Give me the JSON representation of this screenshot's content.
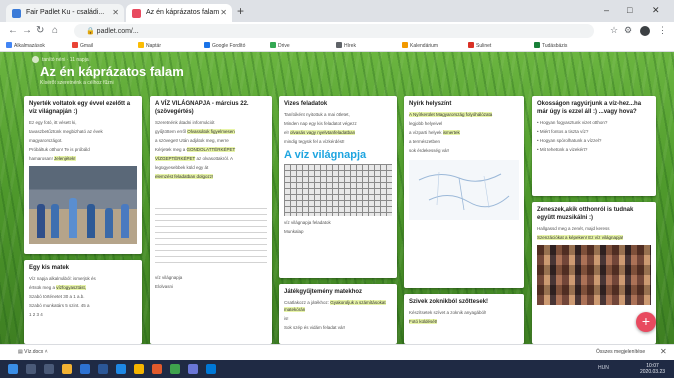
{
  "browser": {
    "tabs": [
      {
        "label": "Fair Padlet Ku - családi..."
      },
      {
        "label": "Az én káprázatos falam"
      }
    ],
    "new_tab": "+",
    "url": "padlet.com/...",
    "window_controls": {
      "minimize": "–",
      "maximize": "□",
      "close": "✕"
    }
  },
  "bookmarks": [
    {
      "label": "Alkalmazások",
      "color": "#4285f4"
    },
    {
      "label": "Gmail",
      "color": "#e94335"
    },
    {
      "label": "Naptár",
      "color": "#fbbc04"
    },
    {
      "label": "Google Fordító",
      "color": "#1a73e8"
    },
    {
      "label": "Drive",
      "color": "#34a853"
    },
    {
      "label": "Hírek",
      "color": "#5f6368"
    },
    {
      "label": "Kalendárium",
      "color": "#f29900"
    },
    {
      "label": "Sulinet",
      "color": "#d93025"
    },
    {
      "label": "Tudásbázis",
      "color": "#188038"
    }
  ],
  "padlet": {
    "author": "tanító néni · 11 napja",
    "title": "Az én káprázatos falam",
    "subtitle": "Kísérőt szeretnénk a célhoz fűzni",
    "cards": [
      {
        "title": "Nyerték voltatok egy évvel ezelőtt a víz világnapján :)",
        "lines": [
          "Ez egy fotó, itt vésett ki,",
          "tavaszbetűztünk megbizható az évek",
          "magyarországot.",
          "Próbáltuk otthon! Te is próbáld",
          "hamarosan!",
          "Jelenjétek!"
        ]
      },
      {
        "title": "Egy kis matek",
        "lines": [
          "Víz napja alkalmából: ismerjük és",
          "értsük meg a",
          "vízfogyasztást,",
          "Szabó történetet 30 a 1 a.b.",
          "Szabó munkatárs 5 szint. 45 a",
          "1 2 3 4"
        ]
      },
      {
        "title": "A VÍZ VILÁGNAPJA - március 22. (szövegértés)",
        "lines": [
          "Szeretnénk átadni információt",
          "gyűjtöttem erről",
          "Olvassátok figyelmesen",
          "a szöveget! Után adjátok meg, merre",
          "Kérjetek meg a",
          "GONDOLATTÉRKÉPET",
          "VÍZGEPTÉRKÉPET",
          "az olvasottakról. A",
          "legügyesebbek küld egy át",
          "elemzést feladatban dolgozz!"
        ],
        "doc": "víz világnapja",
        "doc_sub": "Elolvasni"
      },
      {
        "title": "Vizes feladatok",
        "lines": [
          "Tanítóként nyitottuk a mai ötletet,",
          "Minden nap egy kis feladatot végezz",
          "el!",
          "olvasás vagy nyelvtanfeladatban",
          "mindig tegyük fel a vízkérdést!"
        ],
        "highlight": "A víz világnapja",
        "img_caption": "víz világnapja feladatok",
        "img_sub": "Munkalap"
      },
      {
        "title": "Játékgyűjtemény matekhoz",
        "lines": [
          "Csatlakozz a játékhoz:",
          "Gyakoroljuk a számításokat matekórán",
          "is!",
          "Sok szép és vidám feladat vár!"
        ]
      },
      {
        "title": "Nyírk helyszínt",
        "lines": [
          "A Nyírkerület Magyarország folyóhálózata",
          "legjobb helyeivel",
          "a vízparti helyek",
          "ismertek",
          "a természetben",
          "sok érdekesség vár!"
        ]
      },
      {
        "title": "Szivek zoknikból szőttesek!",
        "lines": [
          "Készítsetek szívet a zoknik anyagából!",
          "Fotó küldését!"
        ]
      },
      {
        "title": "Okosságon ragyúrjunk a víz-hez...ha már úgy is ezzel áll :) ...vagy hova?",
        "lines": [
          "• Hogyan fogyasztunk vizet otthon?",
          "• Miért fontos a tiszta víz?",
          "• Hogyan spórolhatunk a vízzel?",
          "• Mit tehetünk a vizekért?"
        ]
      },
      {
        "title": "Zeneszek,akik otthonról is tudnak együtt muzsikálni :)",
        "lines": [
          "Hallgassd meg a zenét, majd keress",
          "Szenzációkat a képeken! Ez víz világnapja!"
        ]
      }
    ],
    "fab": "+"
  },
  "download_bar": {
    "item": "Víz.docx",
    "show_all": "Összes megjelenítése",
    "close": "✕"
  },
  "taskbar": {
    "clock_time": "10:07",
    "clock_date": "2020.03.23",
    "tray": "HUN"
  }
}
